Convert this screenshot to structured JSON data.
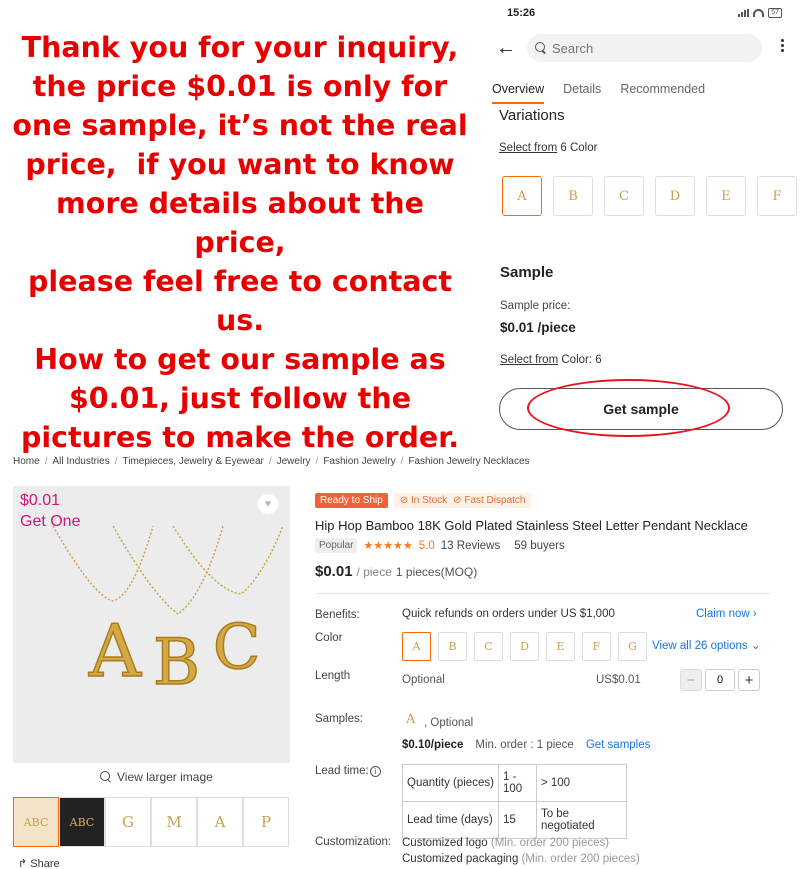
{
  "notice": {
    "lines": [
      "Thank you for your inquiry,",
      "the price $0.01 is only for",
      "one sample, it’s not the real",
      "price,  if you want to know",
      "more details about the price,",
      "please feel free to contact",
      "us.",
      "How to get our sample as",
      "$0.01, just follow the",
      "pictures to make the order."
    ]
  },
  "phone": {
    "status_time": "15:26",
    "battery": "57",
    "search_placeholder": "Search",
    "tabs": [
      "Overview",
      "Details",
      "Recommended"
    ],
    "variations_title": "Variations",
    "select_from_link": "Select from",
    "select_from_rest": " 6 Color",
    "swatches": [
      "A",
      "B",
      "C",
      "D",
      "E",
      "F"
    ],
    "sample_title": "Sample",
    "sample_price_label": "Sample price:",
    "sample_price": "$0.01 /piece",
    "sample_select_link": "Select from",
    "sample_select_rest": " Color: 6",
    "get_sample_label": "Get sample"
  },
  "breadcrumb": [
    "Home",
    "All Industries",
    "Timepieces, Jewelry & Eyewear",
    "Jewelry",
    "Fashion Jewelry",
    "Fashion Jewelry Necklaces"
  ],
  "gallery": {
    "price": "$0.01",
    "get_one": "Get One",
    "view_larger": "View larger image",
    "thumbs": [
      "ABC",
      "ABC",
      "G",
      "M",
      "A",
      "P"
    ],
    "share": "Share"
  },
  "product": {
    "badge_rts": "Ready to Ship",
    "badge_stock": "In Stock",
    "badge_dispatch": "Fast Dispatch",
    "title": "Hip Hop Bamboo 18K Gold Plated Stainless Steel Letter Pendant Necklace",
    "popular": "Popular",
    "stars": "★★★★★",
    "rating": "5.0",
    "reviews": "13 Reviews",
    "buyers": "59 buyers",
    "price": "$0.01",
    "price_unit": "/ piece",
    "moq": "1 pieces(MOQ)",
    "benefits_label": "Benefits:",
    "benefits_text": "Quick refunds on orders under US $1,000",
    "claim_now": "Claim now ›",
    "color_label": "Color",
    "color_swatches": [
      "A",
      "B",
      "C",
      "D",
      "E",
      "F",
      "G"
    ],
    "view_all": "View all 26 options ⌄",
    "length_label": "Length",
    "length_value": "Optional",
    "length_price": "US$0.01",
    "quantity": "0",
    "samples_label": "Samples:",
    "samples_optional": ", Optional",
    "samples_price": "$0.10/piece",
    "samples_min_order": "Min. order : 1 piece",
    "get_samples": "Get samples",
    "lead_time_label": "Lead time:",
    "lead_table": [
      [
        "Quantity (pieces)",
        "1 - 100",
        "> 100"
      ],
      [
        "Lead time (days)",
        "15",
        "To be negotiated"
      ]
    ],
    "customization_label": "Customization:",
    "custom_logo": "Customized logo",
    "custom_logo_min": "(Min. order 200 pieces)",
    "custom_packaging": "Customized packaging",
    "custom_packaging_min": "(Min. order 200 pieces)"
  },
  "colors": {
    "notice_red": "#e60000",
    "accent_orange": "#ff6a00",
    "link_blue": "#1a73e8",
    "gallery_price_pink": "#d0147b",
    "star_orange": "#f57a1c"
  }
}
